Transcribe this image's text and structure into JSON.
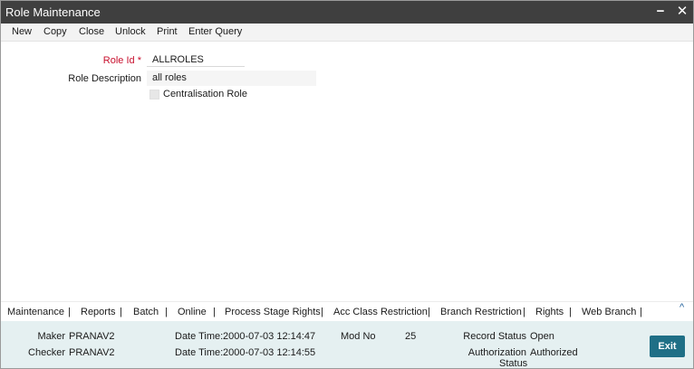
{
  "window": {
    "title": "Role Maintenance",
    "minimize_glyph": "−",
    "close_glyph": "✕"
  },
  "toolbar": {
    "items": [
      "New",
      "Copy",
      "Close",
      "Unlock",
      "Print",
      "Enter Query"
    ]
  },
  "form": {
    "role_id_label": "Role Id",
    "role_id_required": "*",
    "role_id_value": "ALLROLES",
    "role_description_label": "Role Description",
    "role_description_value": "all roles",
    "centralisation_label": "Centralisation Role",
    "centralisation_checked": false
  },
  "subsystems": {
    "links": [
      "Maintenance",
      "Reports",
      "Batch",
      "Online",
      "Process Stage Rights",
      "Acc Class Restriction",
      "Branch Restriction",
      "Rights",
      "Web Branch"
    ],
    "separator": "|",
    "collapse_glyph": "^"
  },
  "audit": {
    "maker_label": "Maker",
    "maker_value": "PRANAV2",
    "maker_datetime_label": "Date Time:",
    "maker_datetime_value": "2000-07-03 12:14:47",
    "checker_label": "Checker",
    "checker_value": "PRANAV2",
    "checker_datetime_label": "Date Time:",
    "checker_datetime_value": "2000-07-03 12:14:55",
    "mod_no_label": "Mod No",
    "mod_no_value": "25",
    "record_status_label": "Record Status",
    "record_status_value": "Open",
    "auth_status_label_1": "Authorization",
    "auth_status_label_2": "Status",
    "auth_status_value": "Authorized",
    "exit_label": "Exit"
  },
  "colors": {
    "titlebar": "#3f3f3f",
    "required": "#c8102e",
    "footer_bg": "#e5f0f1",
    "exit_button": "#1f6f86"
  }
}
